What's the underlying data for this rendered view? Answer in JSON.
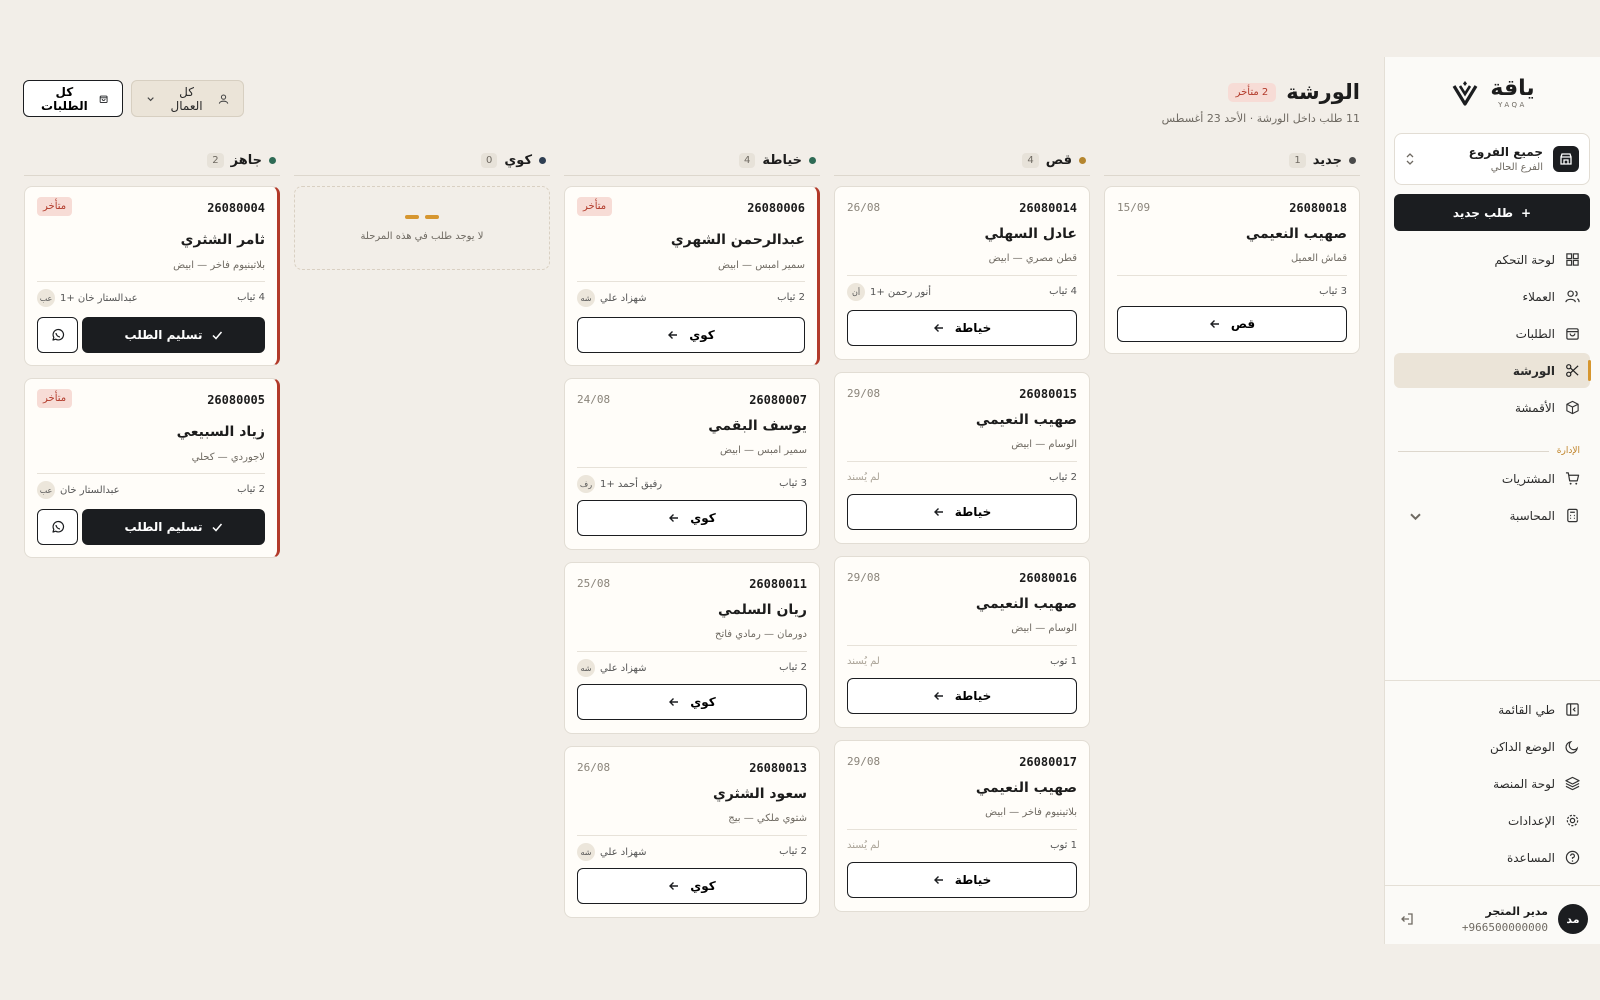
{
  "brand": {
    "name_ar": "ياقة",
    "name_en": "YAQA"
  },
  "branch": {
    "name": "جميع الفروع",
    "sub": "الفرع الحالي"
  },
  "new_order_label": "طلب جديد",
  "nav": {
    "items": [
      {
        "label": "لوحة التحكم",
        "icon": "dashboard-icon"
      },
      {
        "label": "العملاء",
        "icon": "users-icon"
      },
      {
        "label": "الطلبات",
        "icon": "bag-icon"
      },
      {
        "label": "الورشة",
        "icon": "scissors-icon",
        "active": true
      },
      {
        "label": "الأقمشة",
        "icon": "box-icon"
      }
    ],
    "admin_label": "الإدارة",
    "admin_items": [
      {
        "label": "المشتريات",
        "icon": "cart-icon"
      },
      {
        "label": "المحاسبة",
        "icon": "calculator-icon"
      }
    ],
    "bottom_items": [
      {
        "label": "طي القائمة",
        "icon": "collapse-icon"
      },
      {
        "label": "الوضع الداكن",
        "icon": "moon-icon"
      },
      {
        "label": "لوحة المنصة",
        "icon": "layers-icon"
      },
      {
        "label": "الإعدادات",
        "icon": "gear-icon"
      },
      {
        "label": "المساعدة",
        "icon": "help-icon"
      }
    ]
  },
  "user": {
    "initials": "مد",
    "name": "مدير المتجر",
    "phone": "+966500000000"
  },
  "header": {
    "title": "الورشة",
    "late_badge": "2 متأخر",
    "subtitle": "11 طلب داخل الورشة · الأحد 23 أغسطس",
    "all_orders_label": "كل الطلبات",
    "workers_filter_label": "كل العمال"
  },
  "colors": {
    "accent": "#d6962f",
    "dark": "#1b1d20",
    "late": "#b23a2a",
    "bg": "#f2eee8"
  },
  "columns": [
    {
      "title": "جديد",
      "count": "1",
      "dot": "#4a4a4a",
      "cards": [
        {
          "no": "26080018",
          "date": "15/09",
          "name": "صهيب النعيمي",
          "fabric": "قماش العميل",
          "pieces": "3 ثياب",
          "action": "قص"
        }
      ]
    },
    {
      "title": "قص",
      "count": "4",
      "dot": "#b5862f",
      "cards": [
        {
          "no": "26080014",
          "date": "26/08",
          "name": "عادل السهلي",
          "fabric": "قطن مصري — ابيض",
          "pieces": "4 ثياب",
          "worker_ini": "أن",
          "worker": "أنور رحمن +1",
          "action": "خياطة"
        },
        {
          "no": "26080015",
          "date": "29/08",
          "name": "صهيب النعيمي",
          "fabric": "الوسام — ابيض",
          "pieces": "2 ثياب",
          "unassigned": "لم يُسند",
          "action": "خياطة"
        },
        {
          "no": "26080016",
          "date": "29/08",
          "name": "صهيب النعيمي",
          "fabric": "الوسام — ابيض",
          "pieces": "1 ثوب",
          "unassigned": "لم يُسند",
          "action": "خياطة"
        },
        {
          "no": "26080017",
          "date": "29/08",
          "name": "صهيب النعيمي",
          "fabric": "بلاتينيوم فاخر — ابيض",
          "pieces": "1 ثوب",
          "unassigned": "لم يُسند",
          "action": "خياطة"
        }
      ]
    },
    {
      "title": "خياطة",
      "count": "4",
      "dot": "#2e6b55",
      "cards": [
        {
          "no": "26080006",
          "late": "متأخر",
          "name": "عبدالرحمن الشهري",
          "fabric": "سمير امبس — ابيض",
          "pieces": "2 ثياب",
          "worker_ini": "شه",
          "worker": "شهزاد علي",
          "action": "كوي"
        },
        {
          "no": "26080007",
          "date": "24/08",
          "name": "يوسف البقمي",
          "fabric": "سمير امبس — ابيض",
          "pieces": "3 ثياب",
          "worker_ini": "رف",
          "worker": "رفيق أحمد +1",
          "action": "كوي"
        },
        {
          "no": "26080011",
          "date": "25/08",
          "name": "ريان السلمي",
          "fabric": "دورمان — رمادي فاتح",
          "pieces": "2 ثياب",
          "worker_ini": "شه",
          "worker": "شهزاد علي",
          "action": "كوي"
        },
        {
          "no": "26080013",
          "date": "26/08",
          "name": "سعود الشثري",
          "fabric": "شتوي ملكي — بيج",
          "pieces": "2 ثياب",
          "worker_ini": "شه",
          "worker": "شهزاد علي",
          "action": "كوي"
        }
      ]
    },
    {
      "title": "كوي",
      "count": "0",
      "dot": "#2f3e52",
      "empty_text": "لا يوجد طلب في هذه المرحلة",
      "cards": []
    },
    {
      "title": "جاهز",
      "count": "2",
      "dot": "#2e6b55",
      "cards": [
        {
          "no": "26080004",
          "late": "متأخر",
          "name": "ثامر الشثري",
          "fabric": "بلاتينيوم فاخر — ابيض",
          "pieces": "4 ثياب",
          "worker_ini": "عب",
          "worker": "عبدالستار خان +1",
          "deliver": "تسليم الطلب"
        },
        {
          "no": "26080005",
          "late": "متأخر",
          "name": "زياد السبيعي",
          "fabric": "لاجوردي — كحلي",
          "pieces": "2 ثياب",
          "worker_ini": "عب",
          "worker": "عبدالستار خان",
          "deliver": "تسليم الطلب"
        }
      ]
    }
  ]
}
